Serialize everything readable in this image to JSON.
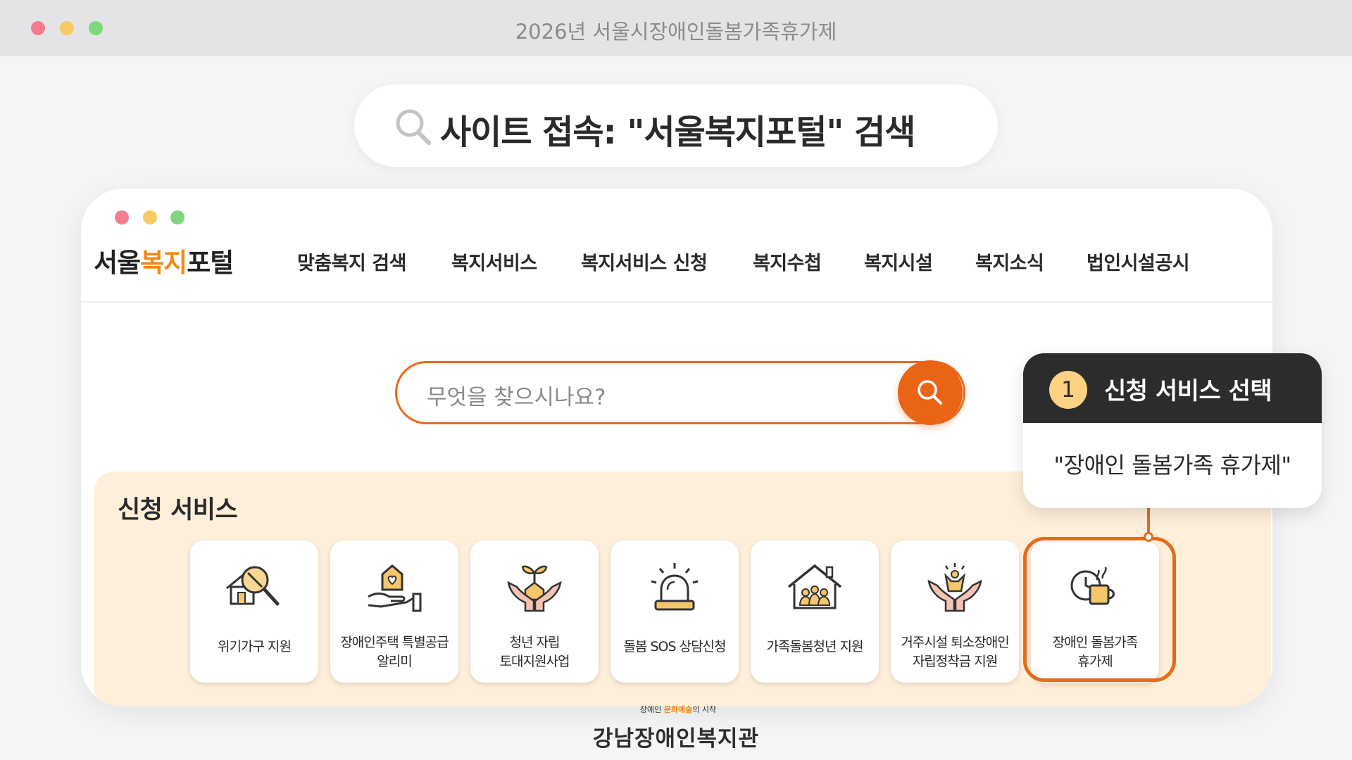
{
  "window": {
    "title": "2026년 서울시장애인돌봄가족휴가제"
  },
  "step_caption": {
    "text": "사이트 접속: \"서울복지포털\" 검색",
    "icon": "search-icon"
  },
  "portal": {
    "logo": {
      "part1": "서울",
      "part2": "복지",
      "part3": "포털"
    },
    "nav": [
      "맞춤복지 검색",
      "복지서비스",
      "복지서비스 신청",
      "복지수첩",
      "복지시설",
      "복지소식",
      "법인시설공시"
    ],
    "search": {
      "placeholder": "무엇을 찾으시나요?",
      "button_icon": "search-icon"
    },
    "services": {
      "title": "신청 서비스",
      "items": [
        {
          "label": "위기가구 지원",
          "icon": "house-magnifier-icon"
        },
        {
          "label": "장애인주택 특별공급\n알리미",
          "icon": "house-hand-icon"
        },
        {
          "label": "청년 자립\n토대지원사업",
          "icon": "sprout-hands-icon"
        },
        {
          "label": "돌봄 SOS 상담신청",
          "icon": "siren-icon"
        },
        {
          "label": "가족돌봄청년 지원",
          "icon": "family-house-icon"
        },
        {
          "label": "거주시설 퇴소장애인\n자립정착금 지원",
          "icon": "person-hands-icon"
        },
        {
          "label": "장애인 돌봄가족\n휴가제",
          "icon": "clock-cup-icon"
        }
      ]
    }
  },
  "callout": {
    "number": "1",
    "title": "신청 서비스 선택",
    "body": "\"장애인 돌봄가족 휴가제\""
  },
  "organization": {
    "tagline_a": "장애인",
    "tagline_b": "문화",
    "tagline_c": "예술",
    "tagline_d": "의 시작",
    "name": "강남장애인복지관"
  },
  "colors": {
    "accent": "#ea6415",
    "panel_bg": "#fdefda",
    "callout_head": "#2c2c2c"
  }
}
